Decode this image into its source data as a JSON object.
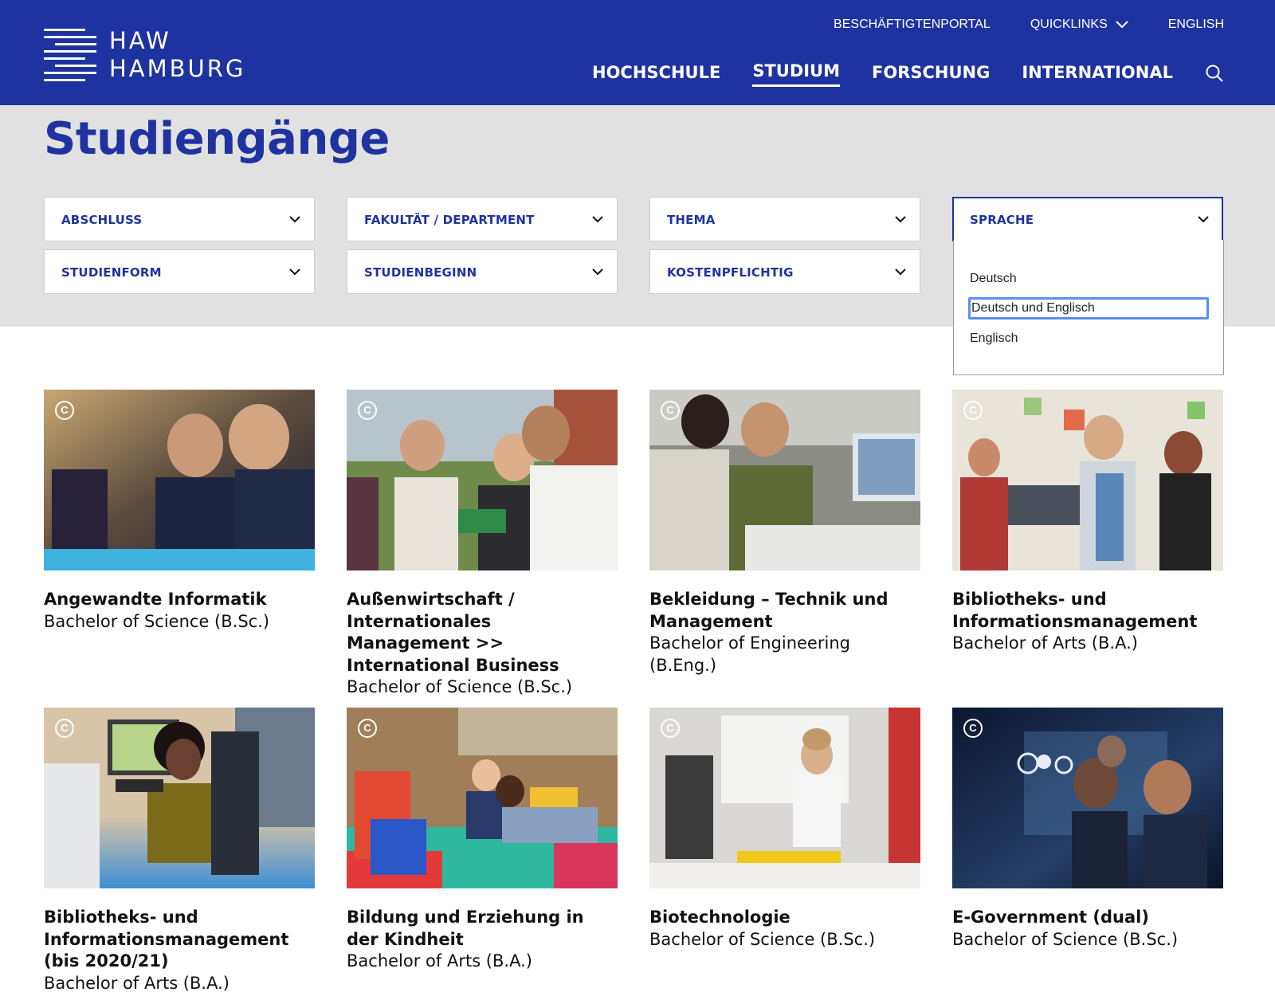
{
  "header": {
    "logo_text": "HAW\nHAMBURG",
    "utility": [
      "BESCHÄFTIGTENPORTAL",
      "QUICKLINKS",
      "ENGLISH"
    ],
    "nav": [
      "HOCHSCHULE",
      "STUDIUM",
      "FORSCHUNG",
      "INTERNATIONAL"
    ],
    "active_nav": "STUDIUM",
    "brand_color": "#1f33a0"
  },
  "page": {
    "title": "Studiengänge"
  },
  "filters": {
    "abschluss": "ABSCHLUSS",
    "fakultaet": "FAKULTÄT / DEPARTMENT",
    "thema": "THEMA",
    "sprache": "SPRACHE",
    "studienform": "STUDIENFORM",
    "studienbeginn": "STUDIENBEGINN",
    "kostenpflichtig": "KOSTENPFLICHTIG"
  },
  "sprache_dropdown": {
    "options": [
      "Deutsch",
      "Deutsch und Englisch",
      "Englisch"
    ],
    "highlighted": "Deutsch und Englisch"
  },
  "cards": [
    {
      "title": "Angewandte Informatik",
      "degree": "Bachelor of Science (B.Sc.)"
    },
    {
      "title": "Außenwirtschaft / Internationales Management >> International Business",
      "degree": "Bachelor of Science (B.Sc.)"
    },
    {
      "title": "Bekleidung – Technik und Management",
      "degree": "Bachelor of Engineering (B.Eng.)"
    },
    {
      "title": "Bibliotheks- und Informationsmanagement",
      "degree": "Bachelor of Arts (B.A.)"
    },
    {
      "title": "Bibliotheks- und Informationsmanagement (bis 2020/21)",
      "degree": "Bachelor of Arts (B.A.)"
    },
    {
      "title": "Bildung und Erziehung in der Kindheit",
      "degree": "Bachelor of Arts (B.A.)"
    },
    {
      "title": "Biotechnologie",
      "degree": "Bachelor of Science (B.Sc.)"
    },
    {
      "title": "E-Government (dual)",
      "degree": "Bachelor of Science (B.Sc.)"
    }
  ],
  "copyright_symbol": "C",
  "icons": [
    "haw-logo-icon",
    "chevron-down-icon",
    "search-icon",
    "copyright-icon"
  ]
}
